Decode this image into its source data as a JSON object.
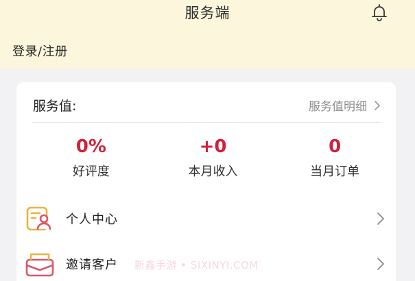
{
  "header": {
    "title": "服务端",
    "login_label": "登录/注册",
    "bell_icon": "bell-icon",
    "background": "#fbf6dc"
  },
  "service_card": {
    "title": "服务值:",
    "detail_link": "服务值明细",
    "stats": [
      {
        "value": "0%",
        "label": "好评度"
      },
      {
        "value": "+0",
        "label": "本月收入"
      },
      {
        "value": "0",
        "label": "当月订单"
      }
    ],
    "value_color": "#d1213b"
  },
  "menu": {
    "items": [
      {
        "label": "个人中心",
        "icon": "id-card-icon",
        "icon_color": "#e9b43c"
      },
      {
        "label": "邀请客户",
        "icon": "envelope-icon",
        "icon_color": "#d9566a"
      }
    ]
  },
  "watermark": "新鑫手游 • SIXINYI.COM"
}
